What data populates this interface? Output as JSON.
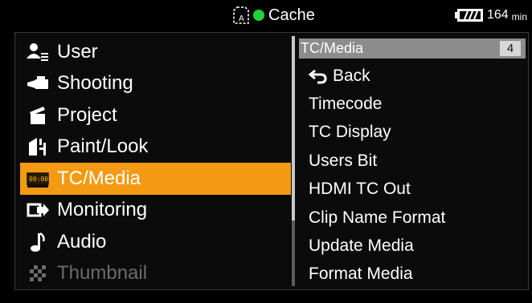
{
  "status": {
    "media_label": "Cache",
    "battery_minutes": "164",
    "battery_unit": "min",
    "indicator_color": "#1fd13a"
  },
  "menu": {
    "items": [
      {
        "label": "User",
        "icon": "user-icon"
      },
      {
        "label": "Shooting",
        "icon": "camera-icon"
      },
      {
        "label": "Project",
        "icon": "clapper-icon"
      },
      {
        "label": "Paint/Look",
        "icon": "paint-icon"
      },
      {
        "label": "TC/Media",
        "icon": "timecode-icon",
        "selected": true
      },
      {
        "label": "Monitoring",
        "icon": "monitor-out-icon"
      },
      {
        "label": "Audio",
        "icon": "music-note-icon"
      },
      {
        "label": "Thumbnail",
        "icon": "thumbnail-icon",
        "disabled": true
      }
    ],
    "accent_color": "#f39a12"
  },
  "submenu": {
    "title": "TC/Media",
    "page": "4",
    "items": [
      "Back",
      "Timecode",
      "TC Display",
      "Users Bit",
      "HDMI TC Out",
      "Clip Name Format",
      "Update Media",
      "Format Media"
    ]
  }
}
